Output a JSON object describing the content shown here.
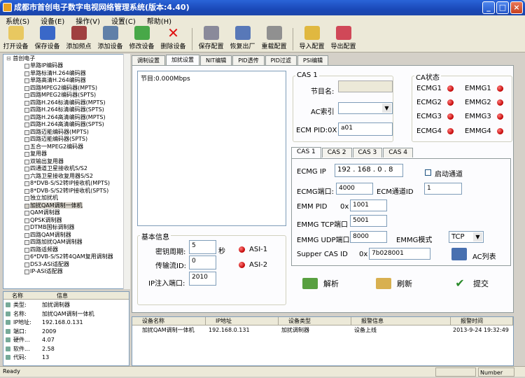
{
  "window": {
    "title": "成都市首创电子数字电视网络管理系统(版本:4.40)"
  },
  "menu": [
    "系统(S)",
    "设备(E)",
    "操作(V)",
    "设置(C)",
    "帮助(H)"
  ],
  "toolbar": [
    "打开设备",
    "保存设备",
    "添加频点",
    "添加设备",
    "修改设备",
    "删除设备",
    "保存配置",
    "恢复出厂",
    "重载配置",
    "导入配置",
    "导出配置"
  ],
  "tree": {
    "root": "首创电子",
    "items": [
      "单路IP编码器",
      "单路标清H.264编码器",
      "单路高清H.264编码器",
      "四路MPEG2编码器(MPTS)",
      "四路MPEG2编码器(SPTS)",
      "四路H.264标清编码器(MPTS)",
      "四路H.264标清编码器(SPTS)",
      "四路H.264高清编码器(MPTS)",
      "四路H.264高清编码器(SPTS)",
      "四路迈能编码器(MPTS)",
      "四路迈能编码器(SPTS)",
      "五合一MPEG2编码器",
      "复用器",
      "双输出复用器",
      "四通道卫星接收机S/S2",
      "六路卫星接收复用器S/S2",
      "8*DVB-S/S2转IP接收机(MPTS)",
      "8*DVB-S/S2转IP接收机(SPTS)",
      "独立加扰机",
      "加扰QAM调制一体机",
      "QAM调制器",
      "QPSK调制器",
      "DTMB国标调制器",
      "四路QAM调制器",
      "四路加扰QAM调制器",
      "四路适频器",
      "6*DVB-S/S2转4QAM复用调制器",
      "DS3-ASI适配器",
      "IP-ASI适配器"
    ],
    "selected": 19
  },
  "info": {
    "h_name": "名称",
    "h_info": "信息",
    "rows": [
      {
        "k": "类型:",
        "v": "加扰调制器"
      },
      {
        "k": "名称:",
        "v": "加扰QAM调制一体机"
      },
      {
        "k": "IP地址:",
        "v": "192.168.0.131"
      },
      {
        "k": "端口:",
        "v": "2009"
      },
      {
        "k": "硬件...",
        "v": "4.07"
      },
      {
        "k": "软件...",
        "v": "2.58"
      },
      {
        "k": "代码:",
        "v": "13"
      }
    ]
  },
  "tabs": [
    "调制设置",
    "加扰设置",
    "NIT编辑",
    "PID透传",
    "PID过滤",
    "PSI编辑"
  ],
  "active_tab": 1,
  "program": "节目:0.000Mbps",
  "cas1": {
    "title": "CAS 1",
    "name_label": "节目名:",
    "name_value": "",
    "ac_label": "AC索引",
    "ecm_label": "ECM PID:0X",
    "ecm_value": "a01"
  },
  "ca_status": {
    "title": "CA状态",
    "items": [
      "ECMG1",
      "EMMG1",
      "ECMG2",
      "EMMG2",
      "ECMG3",
      "EMMG3",
      "ECMG4",
      "EMMG4"
    ]
  },
  "cas_tabs": [
    "CAS 1",
    "CAS 2",
    "CAS 3",
    "CAS 4"
  ],
  "cas_form": {
    "ecmg_ip_label": "ECMG IP",
    "ecmg_ip": " 192 . 168 . 0  . 8",
    "start_label": "启动通道",
    "ecmg_port_label": "ECMG端口:",
    "ecmg_port": "4000",
    "ecm_ch_label": "ECM通道ID",
    "ecm_ch": "1",
    "emm_pid_label": "EMM PID",
    "emm_pid_prefix": "0x",
    "emm_pid": "1001",
    "emmg_tcp_label": "EMMG TCP端口",
    "emmg_tcp": "5001",
    "emmg_udp_label": "EMMG UDP端口",
    "emmg_udp": "8000",
    "emmg_mode_label": "EMMG模式",
    "emmg_mode": "TCP",
    "super_label": "Supper CAS ID",
    "super_prefix": "0x",
    "super_value": "7b028001",
    "ac_list": "AC列表"
  },
  "basic": {
    "title": "基本信息",
    "key_label": "密钥周期:",
    "key_value": "5",
    "key_unit": "秒",
    "asi1": "ASI-1",
    "asi2": "ASI-2",
    "stream_label": "传输流ID:",
    "stream_value": "0",
    "ip_port_label": "IP注入端口:",
    "ip_port_value": "2010"
  },
  "actions": {
    "parse": "解析",
    "refresh": "刷新",
    "submit": "提交"
  },
  "log": {
    "headers": [
      "设备名称",
      "IP地址",
      "设备类型",
      "报警信息",
      "报警时间"
    ],
    "rows": [
      [
        "加扰QAM调制一体机",
        "192.168.0.131",
        "加扰调制器",
        "设备上线",
        "2013-9-24 19:32:49"
      ]
    ]
  },
  "status": {
    "left": "Ready",
    "right": "Number"
  }
}
